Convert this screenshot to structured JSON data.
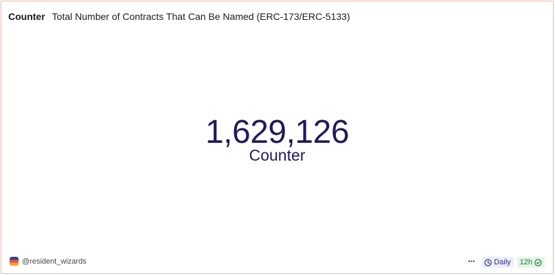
{
  "widget": {
    "type_label": "Counter",
    "title": "Total Number of Contracts That Can Be Named (ERC-173/ERC-5133)",
    "value": "1,629,126",
    "value_label": "Counter"
  },
  "footer": {
    "author": "@resident_wizards",
    "more_label": "···",
    "schedule_label": "Daily",
    "freshness_label": "12h"
  },
  "colors": {
    "border": "#f0b7a4",
    "value_text": "#1f1b5c",
    "schedule_badge": "#eceefb",
    "freshness_badge": "#e3f5e8"
  },
  "icons": [
    "clock-icon",
    "check-circle-icon",
    "avatar"
  ]
}
